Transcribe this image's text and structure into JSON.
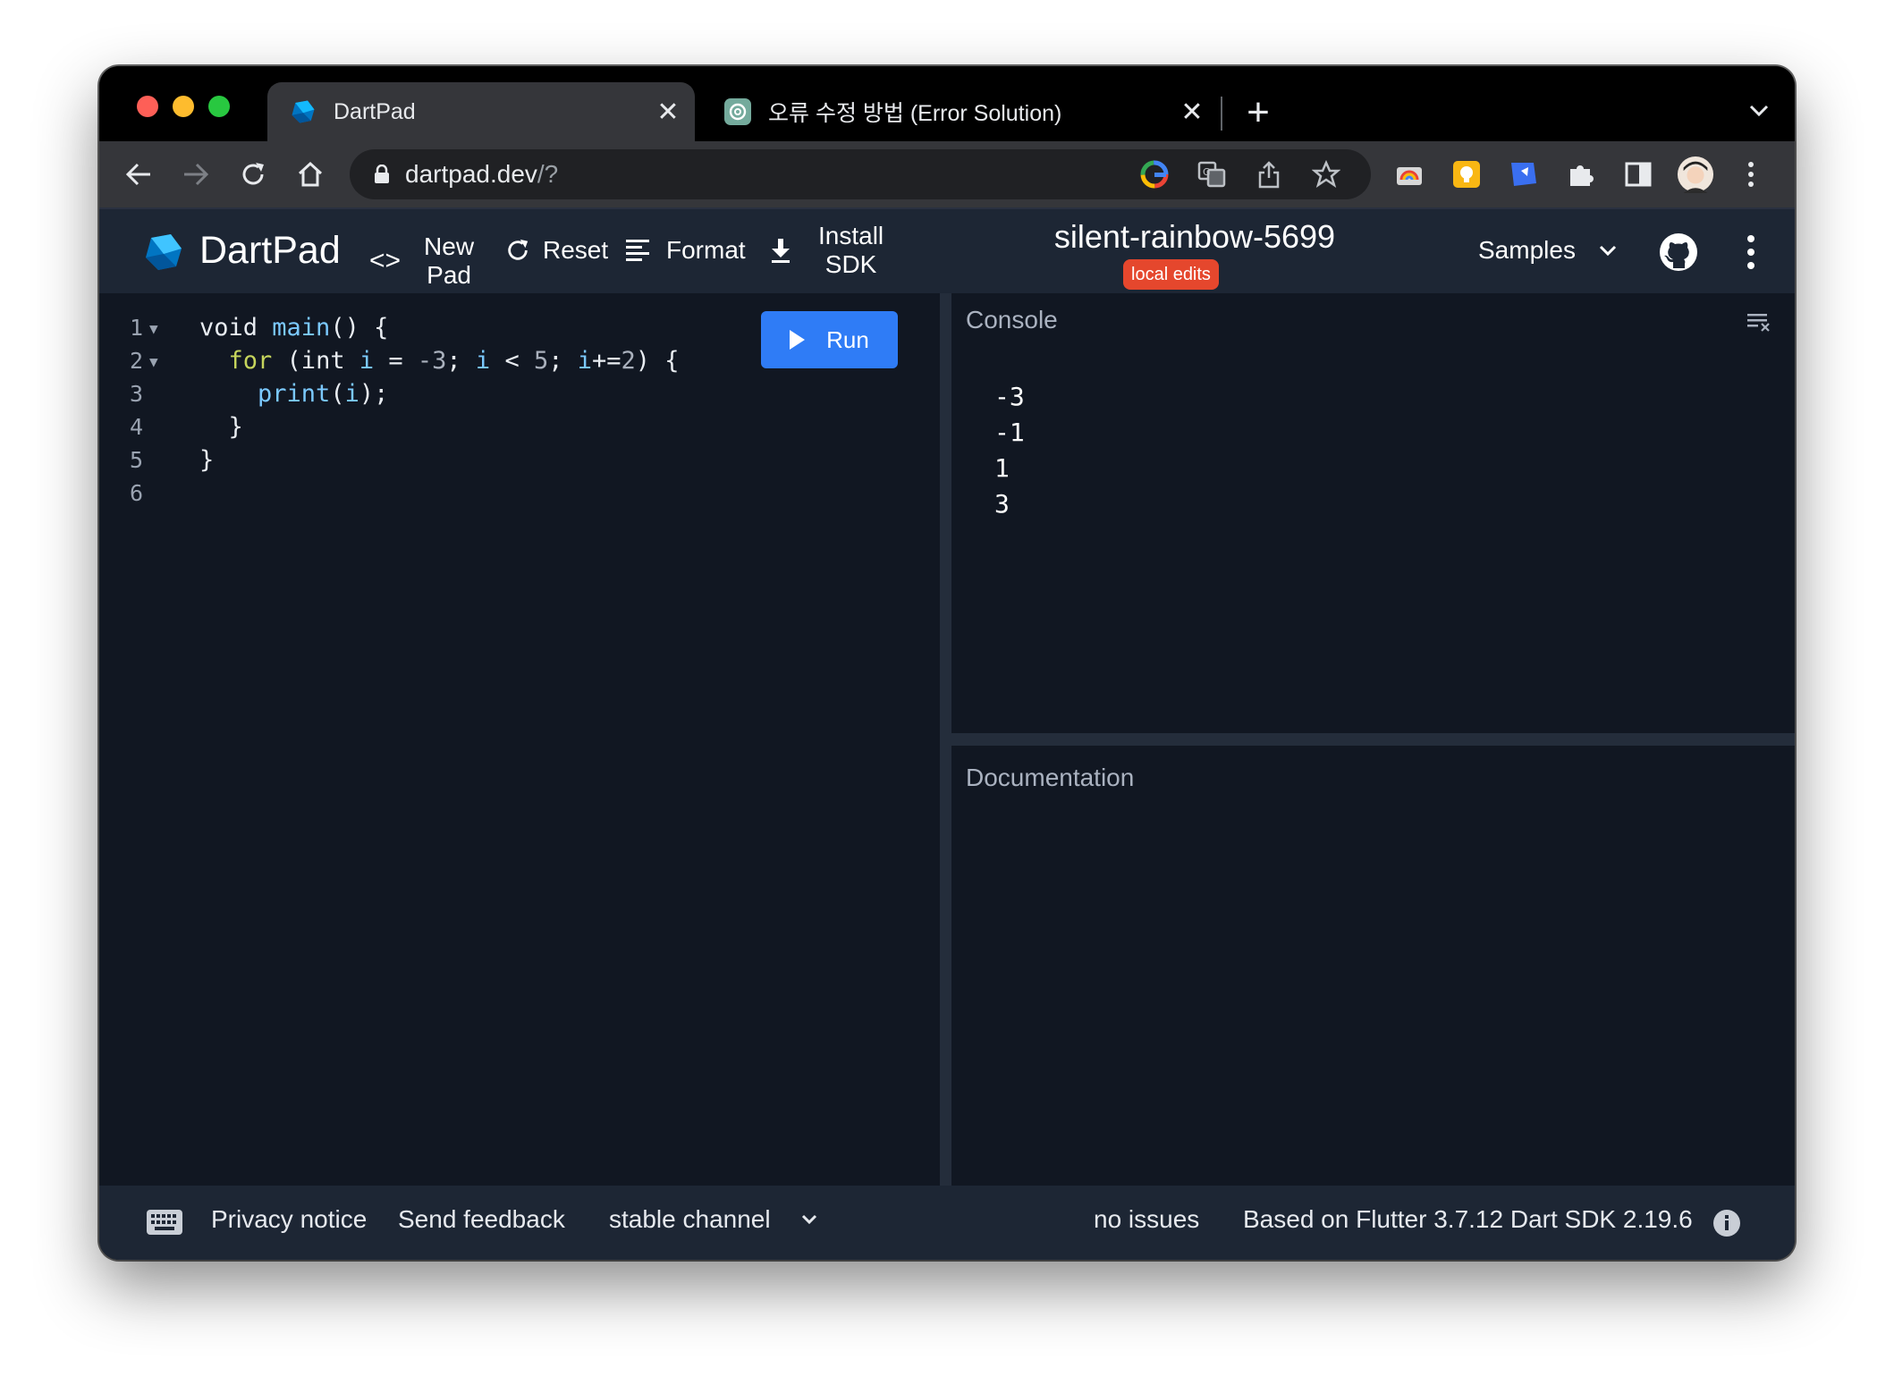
{
  "browser": {
    "tabs": [
      {
        "title": "DartPad",
        "active": true,
        "icon": "dart-logo-icon"
      },
      {
        "title": "오류 수정 방법 (Error Solution)",
        "active": false,
        "icon": "chatgpt-icon"
      }
    ],
    "new_tab_label": "+",
    "url_host": "dartpad.dev",
    "url_rest": "/?"
  },
  "app": {
    "name": "DartPad",
    "toolbar": {
      "new_pad_line1": "New",
      "new_pad_line2": "Pad",
      "reset": "Reset",
      "format": "Format",
      "install_line1": "Install",
      "install_line2": "SDK"
    },
    "pad_name": "silent-rainbow-5699",
    "badge": "local edits",
    "samples": "Samples"
  },
  "editor": {
    "line_numbers": [
      "1",
      "2",
      "3",
      "4",
      "5",
      "6"
    ],
    "run_label": "Run",
    "code_lines": [
      "void main() {",
      "  for (int i = -3; i < 5; i+=2) {",
      "    print(i);",
      "  }",
      "}",
      ""
    ]
  },
  "console": {
    "title": "Console",
    "output": [
      "-3",
      "-1",
      "1",
      "3"
    ]
  },
  "documentation": {
    "title": "Documentation"
  },
  "footer": {
    "privacy": "Privacy notice",
    "feedback": "Send feedback",
    "channel": "stable channel",
    "issues": "no issues",
    "version": "Based on Flutter 3.7.12 Dart SDK 2.19.6"
  },
  "colors": {
    "accent_blue": "#2f7cf6",
    "badge_red": "#e5472d",
    "header_bg": "#1d2634",
    "editor_bg": "#111722"
  }
}
